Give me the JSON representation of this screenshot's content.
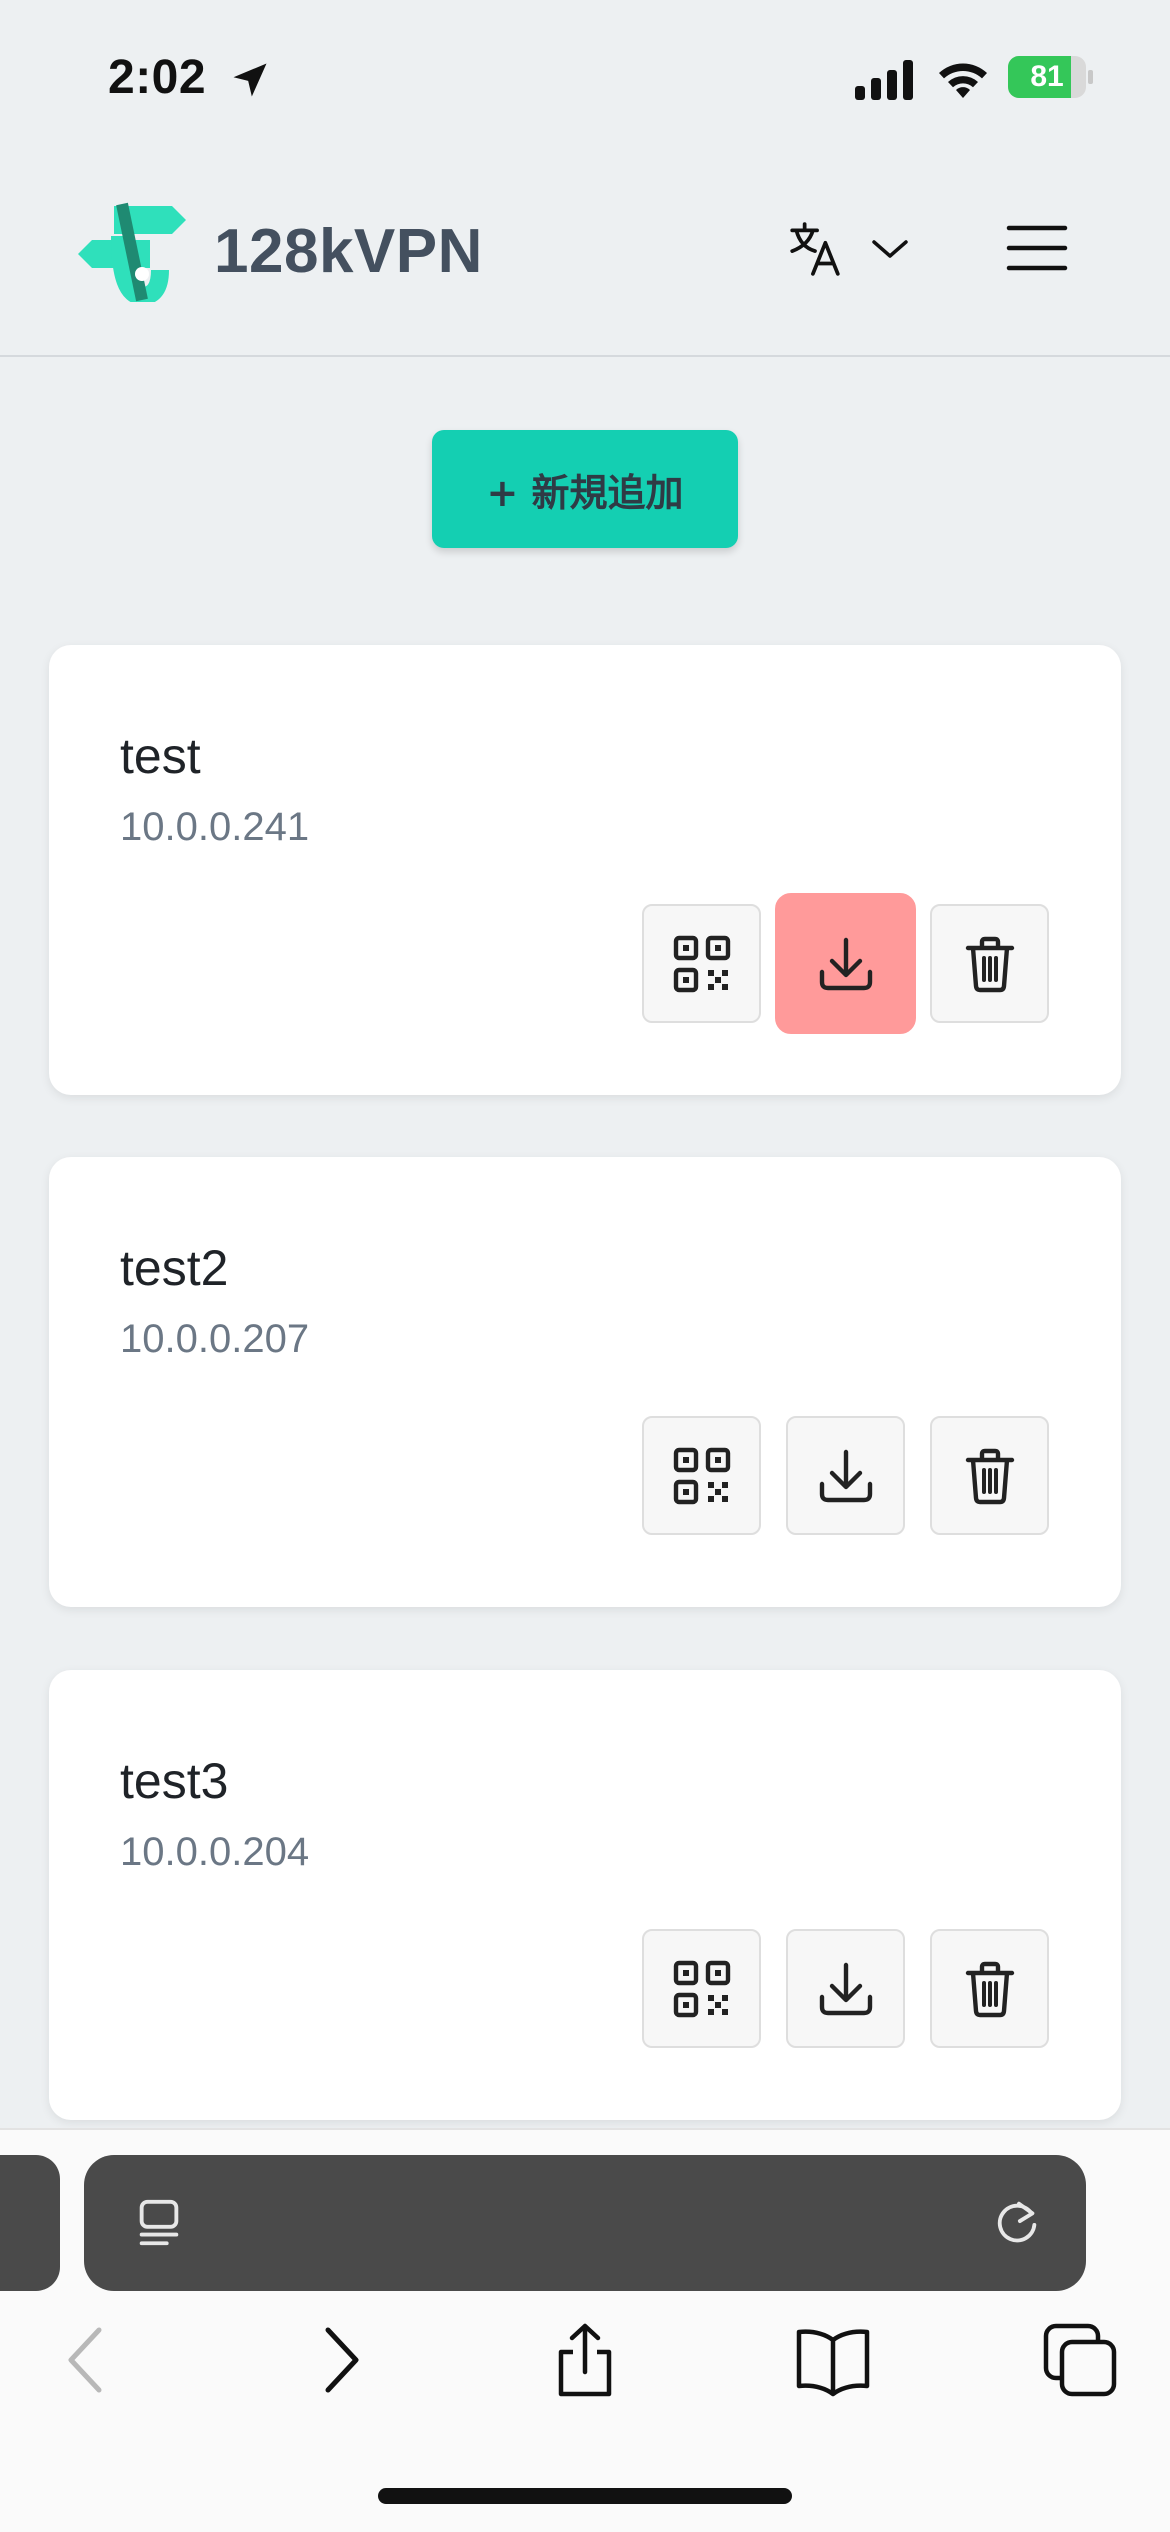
{
  "status_bar": {
    "time": "2:02",
    "battery_level": "81",
    "battery_fraction": 0.81,
    "icons": [
      "location-arrow-icon",
      "cellular-signal-icon",
      "wifi-icon",
      "battery-charging-icon"
    ]
  },
  "header": {
    "brand_name": "128kVPN",
    "logo_colors": [
      "#2fe0bb",
      "#1f8a72"
    ],
    "language_icon": "translate-icon",
    "menu_icon": "hamburger-icon"
  },
  "actions": {
    "add_label": "+ 新規追加",
    "accent_color": "#14cfb2"
  },
  "clients": [
    {
      "name": "test",
      "ip": "10.0.0.241"
    },
    {
      "name": "test2",
      "ip": "10.0.0.207"
    },
    {
      "name": "test3",
      "ip": "10.0.0.204"
    }
  ],
  "client_buttons": {
    "qr_icon": "qr-code-icon",
    "download_icon": "download-icon",
    "delete_icon": "trash-icon",
    "pressed_color": "#ff9a9a"
  },
  "browser_toolbar": {
    "icons": [
      "back-icon",
      "forward-icon",
      "share-icon",
      "bookmarks-icon",
      "tabs-icon"
    ]
  }
}
